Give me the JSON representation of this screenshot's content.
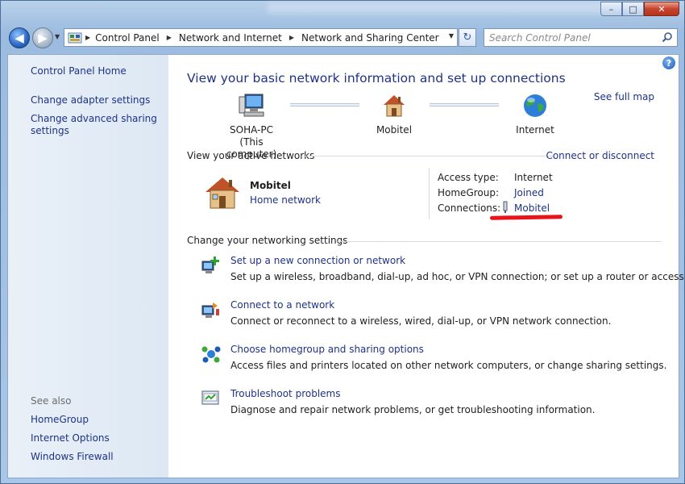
{
  "window": {
    "controls": {
      "minimize": "–",
      "maximize": "□",
      "close": "✕"
    }
  },
  "nav": {
    "breadcrumbs": [
      "Control Panel",
      "Network and Internet",
      "Network and Sharing Center"
    ],
    "search_placeholder": "Search Control Panel"
  },
  "sidebar": {
    "home": "Control Panel Home",
    "links": [
      "Change adapter settings",
      "Change advanced sharing settings"
    ],
    "see_also_label": "See also",
    "see_also": [
      "HomeGroup",
      "Internet Options",
      "Windows Firewall"
    ]
  },
  "main": {
    "heading": "View your basic network information and set up connections",
    "see_full_map": "See full map",
    "map": {
      "computer_name": "SOHA-PC",
      "computer_note": "(This computer)",
      "network": "Mobitel",
      "internet": "Internet"
    },
    "active_networks": {
      "label": "View your active networks",
      "connect_link": "Connect or disconnect",
      "network_name": "Mobitel",
      "network_type": "Home network",
      "access_type_label": "Access type:",
      "access_type_value": "Internet",
      "homegroup_label": "HomeGroup:",
      "homegroup_value": "Joined",
      "connections_label": "Connections:",
      "connections_value": "Mobitel"
    },
    "settings": {
      "label": "Change your networking settings",
      "tasks": [
        {
          "link": "Set up a new connection or network",
          "desc": "Set up a wireless, broadband, dial-up, ad hoc, or VPN connection; or set up a router or access point."
        },
        {
          "link": "Connect to a network",
          "desc": "Connect or reconnect to a wireless, wired, dial-up, or VPN network connection."
        },
        {
          "link": "Choose homegroup and sharing options",
          "desc": "Access files and printers located on other network computers, or change sharing settings."
        },
        {
          "link": "Troubleshoot problems",
          "desc": "Diagnose and repair network problems, or get troubleshooting information."
        }
      ]
    }
  },
  "colors": {
    "link": "#1e3287",
    "highlight_underline": "#e8141a"
  }
}
